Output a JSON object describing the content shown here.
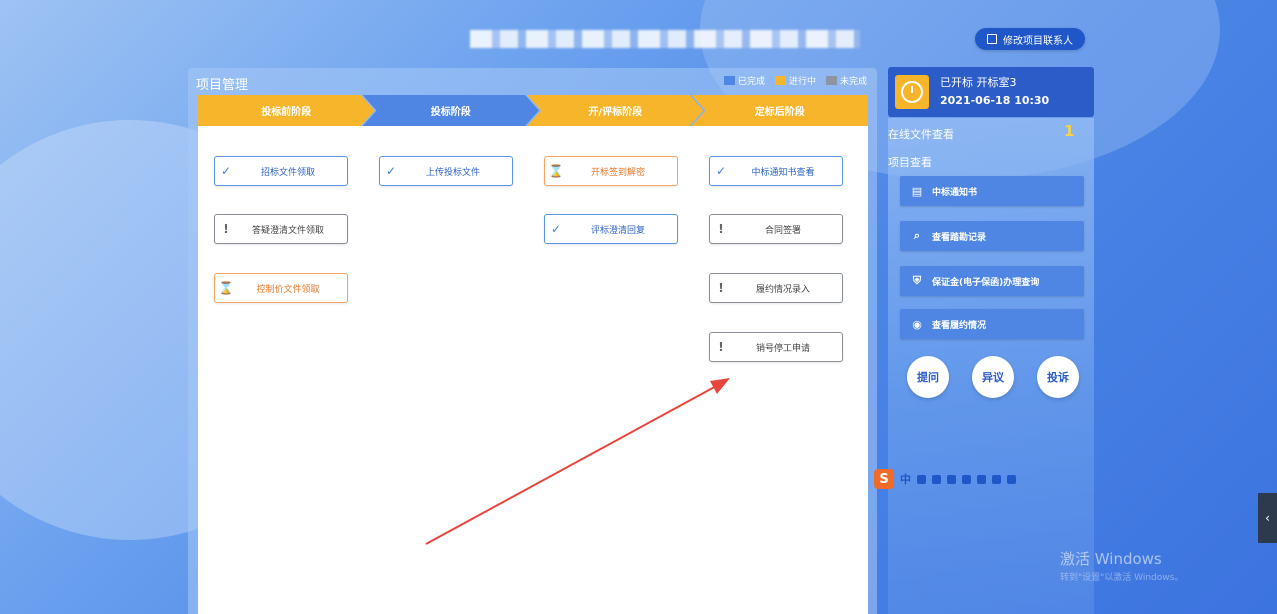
{
  "header": {
    "edit_contact_label": "修改项目联系人"
  },
  "panel": {
    "title": "项目管理",
    "legend": [
      {
        "label": "已完成",
        "color": "#4f86e3"
      },
      {
        "label": "进行中",
        "color": "#f6b52a"
      },
      {
        "label": "未完成",
        "color": "#8d95a3"
      }
    ],
    "stages": [
      {
        "label": "投标前阶段",
        "status": "orange"
      },
      {
        "label": "投标阶段",
        "status": "blue"
      },
      {
        "label": "开/评标阶段",
        "status": "orange"
      },
      {
        "label": "定标后阶段",
        "status": "orange"
      }
    ],
    "tasks": [
      {
        "label": "招标文件领取",
        "status": "done",
        "icon": "check-icon",
        "glyph": "✓"
      },
      {
        "label": "答疑澄清文件领取",
        "status": "pending",
        "icon": "exclamation-icon",
        "glyph": "!"
      },
      {
        "label": "控制价文件领取",
        "status": "in-progress",
        "icon": "hourglass-icon",
        "glyph": "⌛"
      },
      {
        "label": "上传投标文件",
        "status": "done",
        "icon": "check-icon",
        "glyph": "✓"
      },
      {
        "label": "开标签到解密",
        "status": "in-progress",
        "icon": "hourglass-icon",
        "glyph": "⌛"
      },
      {
        "label": "评标澄清回复",
        "status": "done",
        "icon": "check-icon",
        "glyph": "✓"
      },
      {
        "label": "中标通知书查看",
        "status": "done",
        "icon": "check-icon",
        "glyph": "✓"
      },
      {
        "label": "合同签署",
        "status": "pending",
        "icon": "exclamation-icon",
        "glyph": "!"
      },
      {
        "label": "履约情况录入",
        "status": "pending",
        "icon": "exclamation-icon",
        "glyph": "!"
      },
      {
        "label": "销号停工申请",
        "status": "pending",
        "icon": "exclamation-icon",
        "glyph": "!"
      }
    ]
  },
  "sidebar": {
    "status_line": "已开标 开标室3",
    "datetime": "2021-06-18 10:30",
    "online_files_label": "在线文件查看",
    "online_files_count": "1",
    "project_view_label": "项目查看",
    "buttons": [
      {
        "label": "中标通知书",
        "icon": "document-icon",
        "glyph": "▤"
      },
      {
        "label": "查看踏勘记录",
        "icon": "search-document-icon",
        "glyph": "⌕"
      },
      {
        "label": "保证金(电子保函)办理查询",
        "icon": "shield-icon",
        "glyph": "⛨"
      },
      {
        "label": "查看履约情况",
        "icon": "eye-icon",
        "glyph": "◉"
      }
    ],
    "circle_buttons": [
      "提问",
      "异议",
      "投诉"
    ]
  },
  "ime_toolbar": {
    "s_label": "S",
    "lang_label": "中"
  },
  "watermark": {
    "line1": "激活 Windows",
    "line2": "转到\"设置\"以激活 Windows。"
  },
  "edge_tab_glyph": "‹"
}
